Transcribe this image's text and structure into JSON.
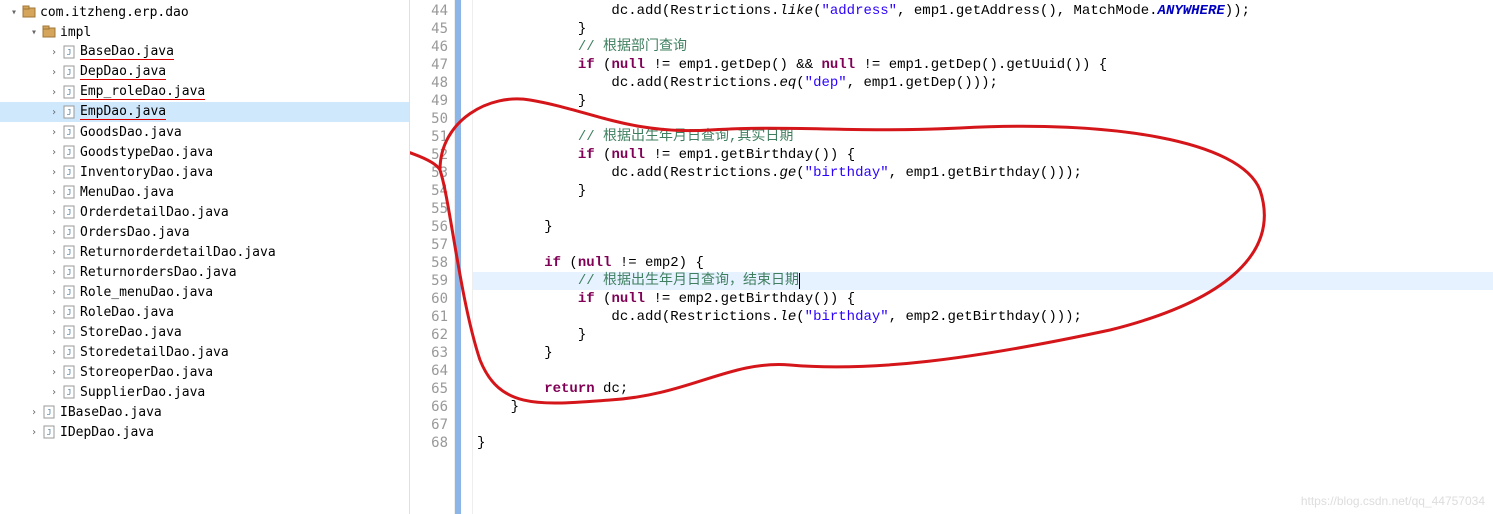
{
  "tree": {
    "root": {
      "label": "com.itzheng.erp.dao"
    },
    "impl": {
      "label": "impl"
    },
    "files": [
      {
        "label": "BaseDao.java",
        "sel": false,
        "type": "java",
        "ul": true
      },
      {
        "label": "DepDao.java",
        "sel": false,
        "type": "java",
        "ul": true
      },
      {
        "label": "Emp_roleDao.java",
        "sel": false,
        "type": "java",
        "ul": true
      },
      {
        "label": "EmpDao.java",
        "sel": true,
        "type": "java",
        "ul": true
      },
      {
        "label": "GoodsDao.java",
        "sel": false,
        "type": "java",
        "ul": false
      },
      {
        "label": "GoodstypeDao.java",
        "sel": false,
        "type": "java",
        "ul": false
      },
      {
        "label": "InventoryDao.java",
        "sel": false,
        "type": "java",
        "ul": false
      },
      {
        "label": "MenuDao.java",
        "sel": false,
        "type": "java",
        "ul": false
      },
      {
        "label": "OrderdetailDao.java",
        "sel": false,
        "type": "java",
        "ul": false
      },
      {
        "label": "OrdersDao.java",
        "sel": false,
        "type": "java",
        "ul": false
      },
      {
        "label": "ReturnorderdetailDao.java",
        "sel": false,
        "type": "java",
        "ul": false
      },
      {
        "label": "ReturnordersDao.java",
        "sel": false,
        "type": "java",
        "ul": false
      },
      {
        "label": "Role_menuDao.java",
        "sel": false,
        "type": "java",
        "ul": false
      },
      {
        "label": "RoleDao.java",
        "sel": false,
        "type": "java",
        "ul": false
      },
      {
        "label": "StoreDao.java",
        "sel": false,
        "type": "java",
        "ul": false
      },
      {
        "label": "StoredetailDao.java",
        "sel": false,
        "type": "java",
        "ul": false
      },
      {
        "label": "StoreoperDao.java",
        "sel": false,
        "type": "java",
        "ul": false
      },
      {
        "label": "SupplierDao.java",
        "sel": false,
        "type": "java",
        "ul": false
      }
    ],
    "ifaces": [
      {
        "label": "IBaseDao.java"
      },
      {
        "label": "IDepDao.java"
      }
    ]
  },
  "gutter": {
    "start": 44,
    "end": 68
  },
  "code": {
    "l44": {
      "indent": "                ",
      "pre": "dc.add(Restrictions.",
      "m": "like",
      "a": "(",
      "s": "\"address\"",
      "b": ", emp1.getAddress(), MatchMode.",
      "c": "ANYWHERE",
      "d": "));"
    },
    "l45": {
      "text": "            }"
    },
    "l46": {
      "indent": "            ",
      "cmt": "// 根据部门查询"
    },
    "l47": {
      "indent": "            ",
      "kw": "if",
      "a": " (",
      "kw2": "null",
      "b": " != emp1.getDep() && ",
      "kw3": "null",
      "c": " != emp1.getDep().getUuid()) {"
    },
    "l48": {
      "indent": "                ",
      "a": "dc.add(Restrictions.",
      "m": "eq",
      "b": "(",
      "s": "\"dep\"",
      "c": ", emp1.getDep()));"
    },
    "l49": {
      "text": "            }"
    },
    "l50": {
      "text": ""
    },
    "l51": {
      "indent": "            ",
      "cmt": "// 根据出生年月日查询,其实日期"
    },
    "l52": {
      "indent": "            ",
      "kw": "if",
      "a": " (",
      "kw2": "null",
      "b": " != emp1.getBirthday()) {"
    },
    "l53": {
      "indent": "                ",
      "a": "dc.add(Restrictions.",
      "m": "ge",
      "b": "(",
      "s": "\"birthday\"",
      "c": ", emp1.getBirthday()));"
    },
    "l54": {
      "text": "            }"
    },
    "l55": {
      "text": ""
    },
    "l56": {
      "text": "        }"
    },
    "l57": {
      "text": ""
    },
    "l58": {
      "indent": "        ",
      "kw": "if",
      "a": " (",
      "kw2": "null",
      "b": " != emp2) {"
    },
    "l59": {
      "indent": "            ",
      "cmt": "// 根据出生年月日查询，结束日期"
    },
    "l60": {
      "indent": "            ",
      "kw": "if",
      "a": " (",
      "kw2": "null",
      "b": " != emp2.getBirthday()) {"
    },
    "l61": {
      "indent": "                ",
      "a": "dc.add(Restrictions.",
      "m": "le",
      "b": "(",
      "s": "\"birthday\"",
      "c": ", emp2.getBirthday()));"
    },
    "l62": {
      "text": "            }"
    },
    "l63": {
      "text": "        }"
    },
    "l64": {
      "text": ""
    },
    "l65": {
      "indent": "        ",
      "kw": "return",
      "a": " dc;"
    },
    "l66": {
      "text": "    }"
    },
    "l67": {
      "text": ""
    },
    "l68": {
      "text": "}"
    }
  },
  "watermark": "https://blog.csdn.net/qq_44757034"
}
